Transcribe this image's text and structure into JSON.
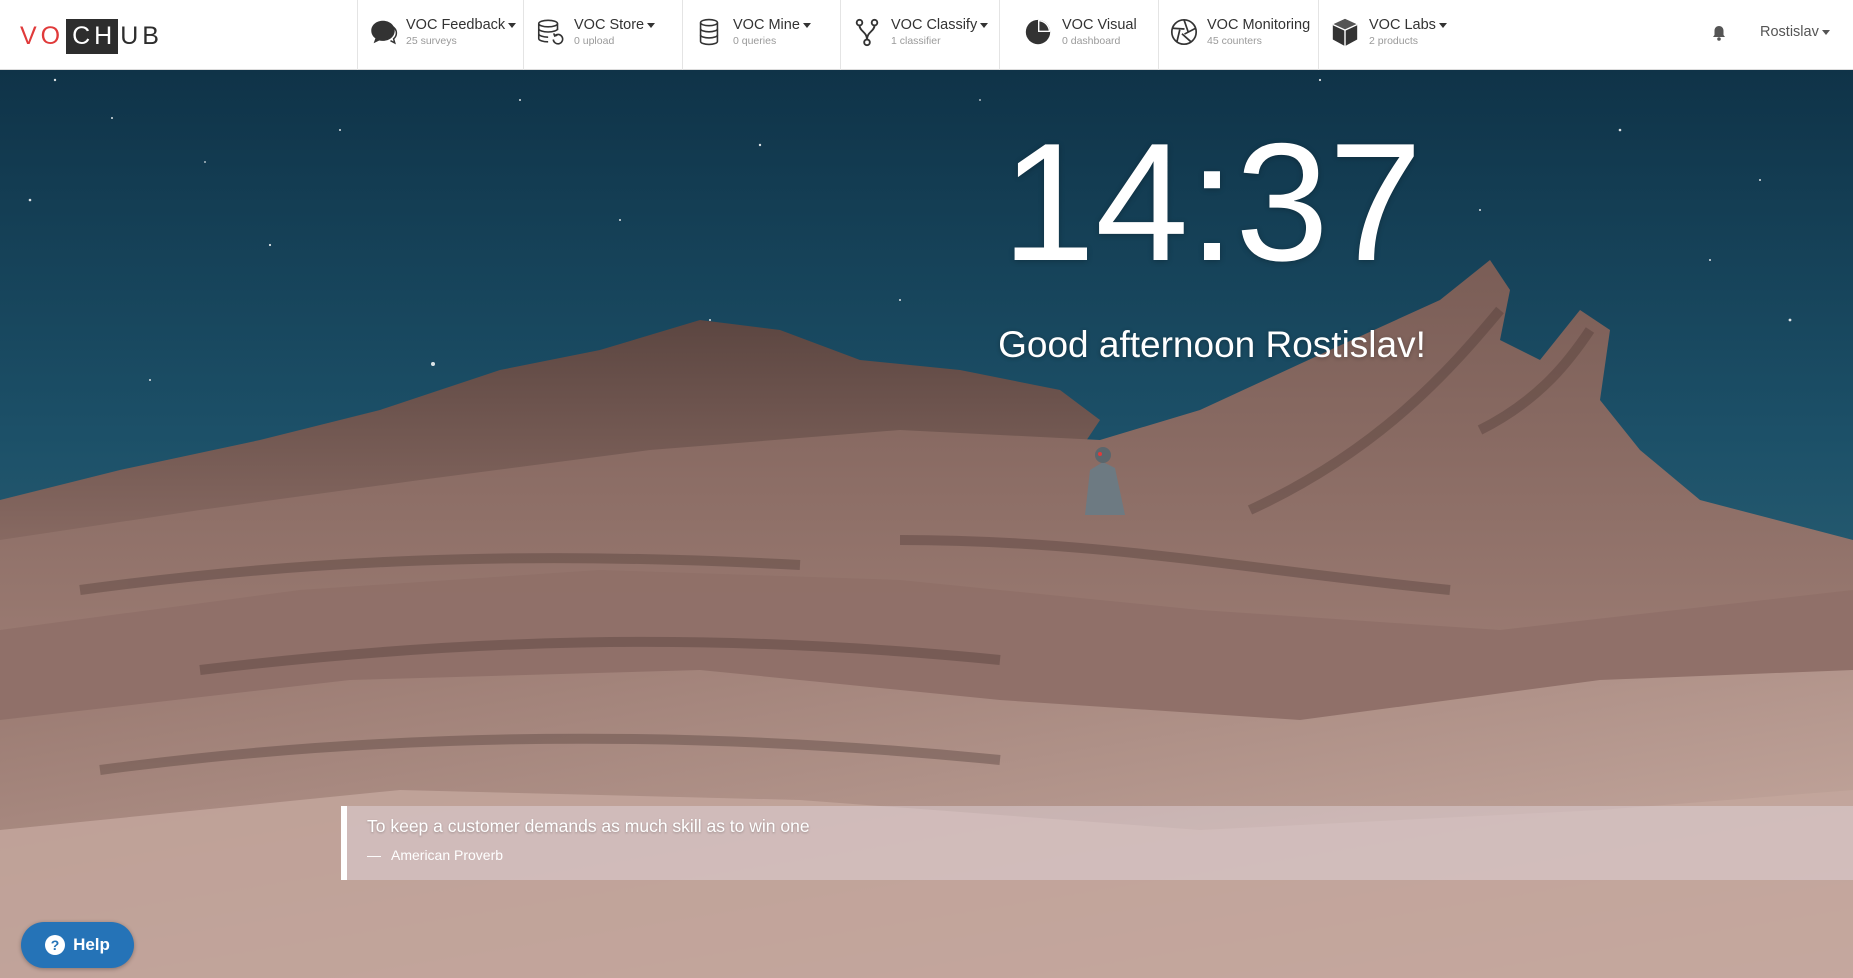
{
  "logo": {
    "part_a": "VO",
    "part_b": "CH",
    "part_c": "UB"
  },
  "nav": {
    "products": [
      {
        "title": "VOC Feedback",
        "subtitle": "25 surveys",
        "icon": "chat-bubble-icon",
        "dropdown": true
      },
      {
        "title": "VOC Store",
        "subtitle": "0 upload",
        "icon": "database-refresh-icon",
        "dropdown": true
      },
      {
        "title": "VOC Mine",
        "subtitle": "0 queries",
        "icon": "database-cylinder-icon",
        "dropdown": true
      },
      {
        "title": "VOC Classify",
        "subtitle": "1 classifier",
        "icon": "fork-icon",
        "dropdown": true
      },
      {
        "title": "VOC Visual",
        "subtitle": "0 dashboard",
        "icon": "pie-chart-icon",
        "dropdown": false
      },
      {
        "title": "VOC Monitoring",
        "subtitle": "45 counters",
        "icon": "aperture-icon",
        "dropdown": false
      },
      {
        "title": "VOC Labs",
        "subtitle": "2 products",
        "icon": "cube-icon",
        "dropdown": true
      }
    ],
    "user_name": "Rostislav"
  },
  "hero": {
    "clock": "14:37",
    "greeting": "Good afternoon Rostislav!"
  },
  "quote": {
    "text": "To keep a customer demands as much skill as to win one",
    "dash": "—",
    "author": "American Proverb"
  },
  "help": {
    "label": "Help",
    "icon_glyph": "?"
  },
  "colors": {
    "logo_red": "#e03a3a",
    "logo_dark": "#2d2d2d",
    "help_blue": "#2573b7",
    "sky_top": "#12354a",
    "rock": "#8a6b63"
  }
}
